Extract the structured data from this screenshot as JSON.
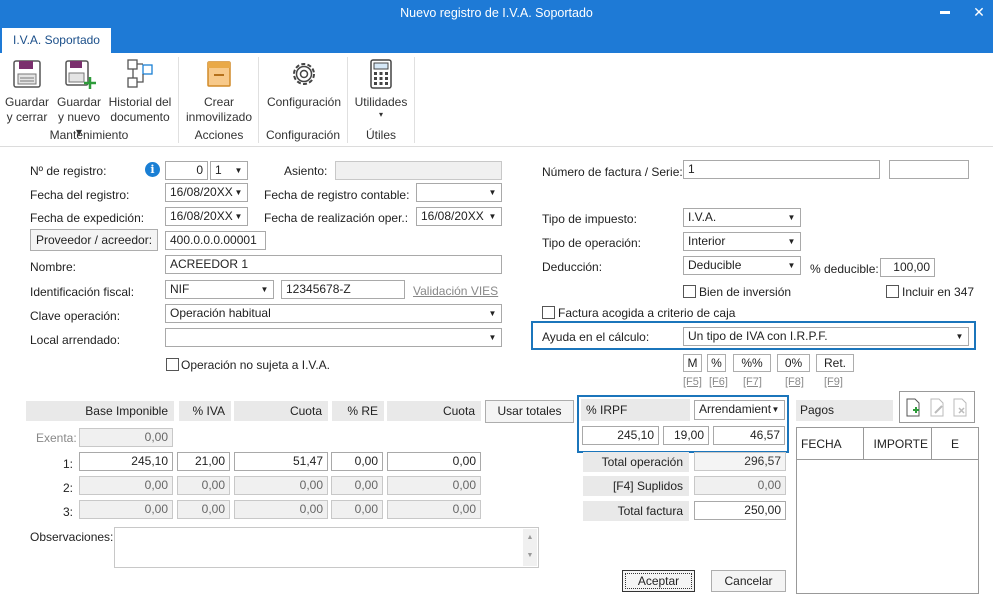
{
  "window": {
    "title": "Nuevo registro de I.V.A. Soportado",
    "minimize": "▬",
    "close": "✕"
  },
  "tab": "I.V.A. Soportado",
  "ribbon": {
    "guardar_cerrar": [
      "Guardar",
      "y cerrar"
    ],
    "guardar_nuevo": [
      "Guardar",
      "y nuevo ▾"
    ],
    "historial": [
      "Historial del",
      "documento"
    ],
    "crear": [
      "Crear",
      "inmovilizado"
    ],
    "configuracion": "Configuración",
    "utilidades": "Utilidades",
    "utilidades_arrow": "▾",
    "groups": {
      "mantenimiento": "Mantenimiento",
      "acciones": "Acciones",
      "configuracion": "Configuración",
      "utiles": "Útiles"
    }
  },
  "form": {
    "n_registro_label": "Nº de registro:",
    "n_registro": "0",
    "n_registro_serie": "1",
    "info": "i",
    "asiento_label": "Asiento:",
    "asiento": "",
    "fecha_registro_label": "Fecha del registro:",
    "fecha_registro": "16/08/20XX",
    "fecha_contable_label": "Fecha de registro contable:",
    "fecha_contable": "",
    "fecha_expedicion_label": "Fecha de expedición:",
    "fecha_expedicion": "16/08/20XX",
    "fecha_oper_label": "Fecha de realización oper.:",
    "fecha_oper": "16/08/20XX",
    "proveedor_btn": "Proveedor / acreedor:",
    "proveedor": "400.0.0.0.00001",
    "nombre_label": "Nombre:",
    "nombre": "ACREEDOR 1",
    "id_fiscal_label": "Identificación fiscal:",
    "id_tipo": "NIF",
    "id_num": "12345678-Z",
    "validacion": "Validación VIES",
    "clave_label": "Clave operación:",
    "clave": "Operación habitual",
    "local_label": "Local arrendado:",
    "local": "",
    "no_sujeta": "Operación no sujeta a I.V.A.",
    "num_factura_label": "Número de factura / Serie:",
    "num_factura": "1",
    "serie": "",
    "tipo_impuesto_label": "Tipo de impuesto:",
    "tipo_impuesto": "I.V.A.",
    "tipo_operacion_label": "Tipo de operación:",
    "tipo_operacion": "Interior",
    "deduccion_label": "Deducción:",
    "deduccion": "Deducible",
    "pct_deducible_label": "% deducible:",
    "pct_deducible": "100,00",
    "bien_inversion": "Bien de inversión",
    "incluir_347": "Incluir en 347",
    "criterio_caja": "Factura acogida a criterio de caja",
    "ayuda_label": "Ayuda en el cálculo:",
    "ayuda": "Un tipo de IVA con I.R.P.F.",
    "quick": [
      {
        "label": "M",
        "key": "[F5]"
      },
      {
        "label": "%",
        "key": "[F6]"
      },
      {
        "label": "%%",
        "key": "[F7]"
      },
      {
        "label": "0%",
        "key": "[F8]"
      },
      {
        "label": "Ret.",
        "key": "[F9]"
      }
    ]
  },
  "grid": {
    "headers": [
      "Base Imponible",
      "% IVA",
      "Cuota",
      "% RE",
      "Cuota"
    ],
    "usar_totales": "Usar totales",
    "exenta_label": "Exenta:",
    "exenta": "0,00",
    "rows": [
      {
        "label": "1:",
        "base": "245,10",
        "iva": "21,00",
        "cuota": "51,47",
        "re": "0,00",
        "cuota_re": "0,00"
      },
      {
        "label": "2:",
        "base": "0,00",
        "iva": "0,00",
        "cuota": "0,00",
        "re": "0,00",
        "cuota_re": "0,00"
      },
      {
        "label": "3:",
        "base": "0,00",
        "iva": "0,00",
        "cuota": "0,00",
        "re": "0,00",
        "cuota_re": "0,00"
      }
    ],
    "observaciones_label": "Observaciones:"
  },
  "irpf": {
    "label": "% IRPF",
    "tipo": "Arrendamient",
    "base": "245,10",
    "pct": "19,00",
    "importe": "46,57"
  },
  "totales": {
    "operacion_label": "Total operación",
    "operacion": "296,57",
    "suplidos_label": "[F4] Suplidos",
    "suplidos": "0,00",
    "factura_label": "Total factura",
    "factura": "250,00"
  },
  "pagos": {
    "title": "Pagos",
    "cols": [
      "FECHA",
      "IMPORTE",
      "E"
    ]
  },
  "buttons": {
    "aceptar": "Aceptar",
    "cancelar": "Cancelar"
  },
  "colors": {
    "titlebar": "#1e7ad6",
    "highlight": "#1b75bb",
    "info": "#1a7fd4"
  }
}
